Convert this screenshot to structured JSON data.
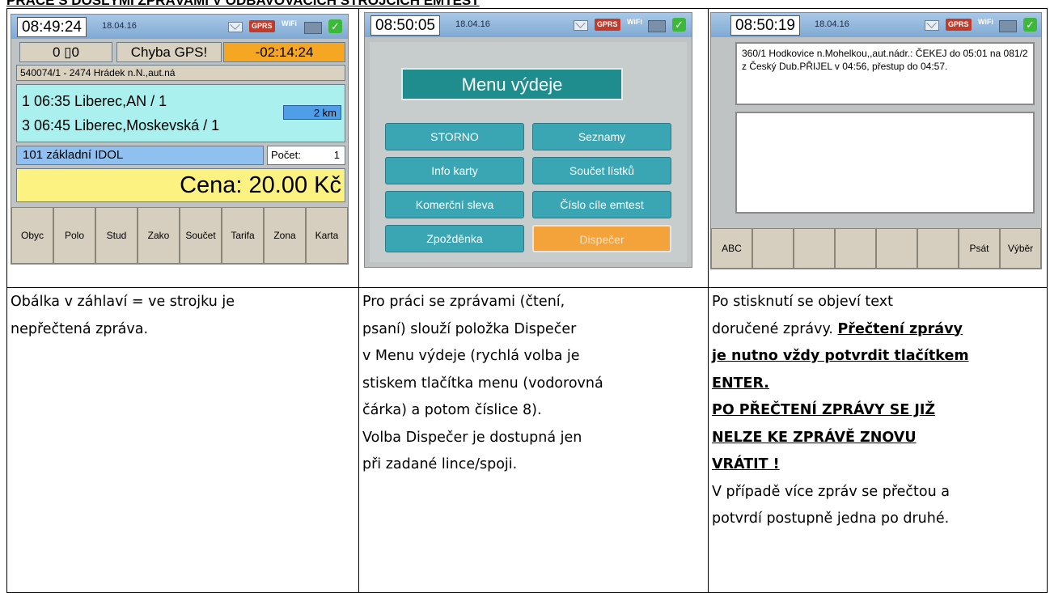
{
  "heading": "PRÁCE S DOŠLÝMI ZPRÁVAMI V ODBAVOVACÍCH STROJCÍCH EMTEST",
  "screens": [
    {
      "clock": "08:49:24",
      "date": "18.04.16",
      "gprs": "GPRS",
      "wifi": "WiFi",
      "counter": "0 ▯0",
      "gps_status": "Chyba GPS!",
      "time_offset": "-02:14:24",
      "route": "540074/1 - 2474 Hrádek n.N.,aut.ná",
      "stop1": "1 06:35 Liberec,AN / 1",
      "distance": "2 km",
      "stop2": "3 06:45 Liberec,Moskevská / 1",
      "tariff": "101 základní IDOL",
      "count_label": "Počet:",
      "count_value": "1",
      "price": "Cena: 20.00 Kč",
      "buttons": [
        "Obyc",
        "Polo",
        "Stud",
        "Zako",
        "Součet",
        "Tarifa",
        "Zona",
        "Karta"
      ]
    },
    {
      "clock": "08:50:05",
      "date": "18.04.16",
      "gprs": "GPRS",
      "wifi": "WiFi",
      "menu_title": "Menu výdeje",
      "items": [
        "STORNO",
        "Seznamy",
        "Info karty",
        "Součet lístků",
        "Komerční sleva",
        "Číslo cíle emtest",
        "Zpožděnka",
        "Dispečer"
      ],
      "selected_item": "Dispečer"
    },
    {
      "clock": "08:50:19",
      "date": "18.04.16",
      "gprs": "GPRS",
      "wifi": "WiFi",
      "message": "360/1 Hodkovice n.Mohelkou,,aut.nádr.: ČEKEJ do 05:01 na 081/2 z Český Dub.PŘIJEL v 04:56, přestup do 04:57.",
      "buttons": [
        "ABC",
        "",
        "",
        "",
        "",
        "",
        "Psát",
        "Výběr"
      ]
    }
  ],
  "descriptions": {
    "col1": [
      "Obálka v záhlaví = ve strojku je",
      "nepřečtená zpráva."
    ],
    "col2": [
      "Pro práci se zprávami (čtení,",
      "psaní) slouží položka Dispečer",
      "v Menu výdeje (rychlá volba je",
      "stiskem tlačítka menu (vodorovná",
      "čárka) a potom číslice 8).",
      "Volba Dispečer je dostupná jen",
      "při zadané lince/spoji."
    ],
    "col3_line1": "Po stisknutí se objeví text",
    "col3_line2": "doručené zprávy.",
    "col3_bold": [
      "Přečtení zprávy",
      "je nutno vždy potvrdit tlačítkem",
      "ENTER.",
      "PO PŘEČTENÍ ZPRÁVY SE JIŽ",
      "NELZE KE ZPRÁVĚ ZNOVU",
      "VRÁTIT !"
    ],
    "col3_end": [
      "V případě více zpráv se přečtou a",
      "potvrdí postupně jedna po druhé."
    ]
  }
}
